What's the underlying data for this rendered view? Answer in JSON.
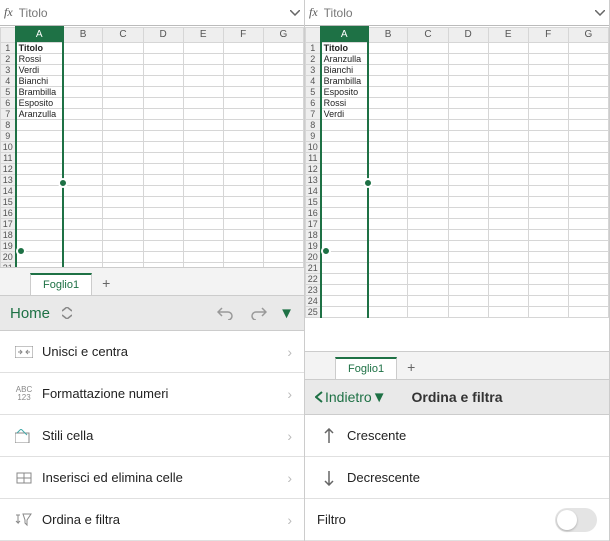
{
  "formula": {
    "fx": "fx",
    "value": "Titolo"
  },
  "columns": [
    "A",
    "B",
    "C",
    "D",
    "E",
    "F",
    "G"
  ],
  "left": {
    "cells": [
      "Titolo",
      "Rossi",
      "Verdi",
      "Bianchi",
      "Brambilla",
      "Esposito",
      "Aranzulla"
    ]
  },
  "right": {
    "cells": [
      "Titolo",
      "Aranzulla",
      "Bianchi",
      "Brambilla",
      "Esposito",
      "Rossi",
      "Verdi"
    ]
  },
  "sheet": {
    "tab": "Foglio1",
    "add": "+"
  },
  "home": {
    "label": "Home",
    "rows": [
      "Unisci e centra",
      "Formattazione numeri",
      "Stili cella",
      "Inserisci ed elimina celle",
      "Ordina e filtra"
    ]
  },
  "sort": {
    "back": "Indietro",
    "title": "Ordina e filtra",
    "asc": "Crescente",
    "desc": "Decrescente",
    "filter": "Filtro"
  }
}
